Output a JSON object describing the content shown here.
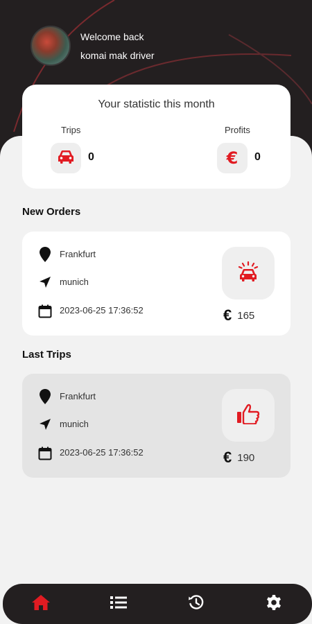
{
  "header": {
    "welcome": "Welcome back",
    "driver_name": "komai mak driver"
  },
  "stats": {
    "title": "Your statistic this month",
    "trips_label": "Trips",
    "trips_value": "0",
    "profits_label": "Profits",
    "profits_value": "0",
    "profits_icon": "euro-icon",
    "trips_icon": "car-icon"
  },
  "new_orders": {
    "title": "New Orders",
    "items": [
      {
        "from": "Frankfurt",
        "to": "munich",
        "datetime": "2023-06-25 17:36:52",
        "currency": "€",
        "price": "165"
      }
    ]
  },
  "last_trips": {
    "title": "Last Trips",
    "items": [
      {
        "from": "Frankfurt",
        "to": "munich",
        "datetime": "2023-06-25 17:36:52",
        "currency": "€",
        "price": "190"
      }
    ]
  },
  "nav": {
    "items": [
      "home-icon",
      "list-icon",
      "history-icon",
      "settings-icon"
    ],
    "active": "home-icon"
  },
  "colors": {
    "accent": "#e11b22",
    "dark": "#231f20",
    "background": "#f2f2f2"
  }
}
